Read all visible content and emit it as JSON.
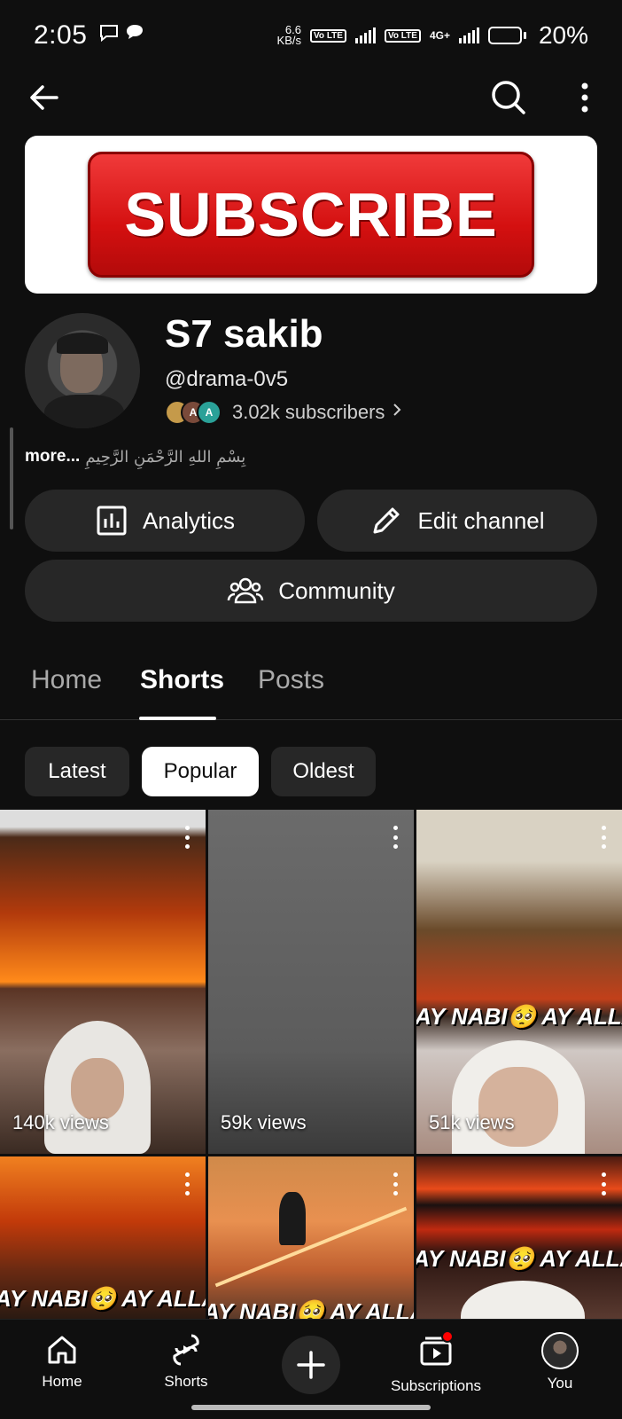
{
  "status_bar": {
    "time": "2:05",
    "speed": "6.6\nKB/s",
    "battery_percent": "20%",
    "net_type": "4G+",
    "volte1": "Vo LTE",
    "volte2": "Vo LTE"
  },
  "banner": {
    "text": "SUBSCRIBE",
    "color": "#e01818"
  },
  "channel": {
    "name": "S7 sakib",
    "handle": "@drama-0v5",
    "subscribers": "3.02k subscribers",
    "subscriber_avatar_letters": [
      "",
      "A",
      "A"
    ],
    "description_more": "more...",
    "description": "بِسْمِ اللهِ الرَّحْمَنِ الرَّحِيمِ"
  },
  "actions": {
    "analytics": "Analytics",
    "edit_channel": "Edit channel",
    "community": "Community"
  },
  "tabs": [
    {
      "label": "Home",
      "active": false
    },
    {
      "label": "Shorts",
      "active": true
    },
    {
      "label": "Posts",
      "active": false
    }
  ],
  "filters": [
    {
      "label": "Latest",
      "active": false
    },
    {
      "label": "Popular",
      "active": true
    },
    {
      "label": "Oldest",
      "active": false
    }
  ],
  "shorts": [
    {
      "views": "140k views",
      "overlay": ""
    },
    {
      "views": "59k views",
      "overlay": ""
    },
    {
      "views": "51k views",
      "overlay": "AY NABI🥺 AY ALLAH"
    },
    {
      "views": "",
      "overlay": "AY NABI🥺 AY ALLAH"
    },
    {
      "views": "",
      "overlay": "AY NABI🥺 AY ALLAH"
    },
    {
      "views": "",
      "overlay": "AY NABI🥺 AY ALLAH"
    }
  ],
  "bottom_nav": {
    "home": "Home",
    "shorts": "Shorts",
    "subscriptions": "Subscriptions",
    "you": "You"
  },
  "colors": {
    "accent_red": "#ff0000",
    "chip_active_bg": "#ffffff",
    "surface": "#272727"
  }
}
